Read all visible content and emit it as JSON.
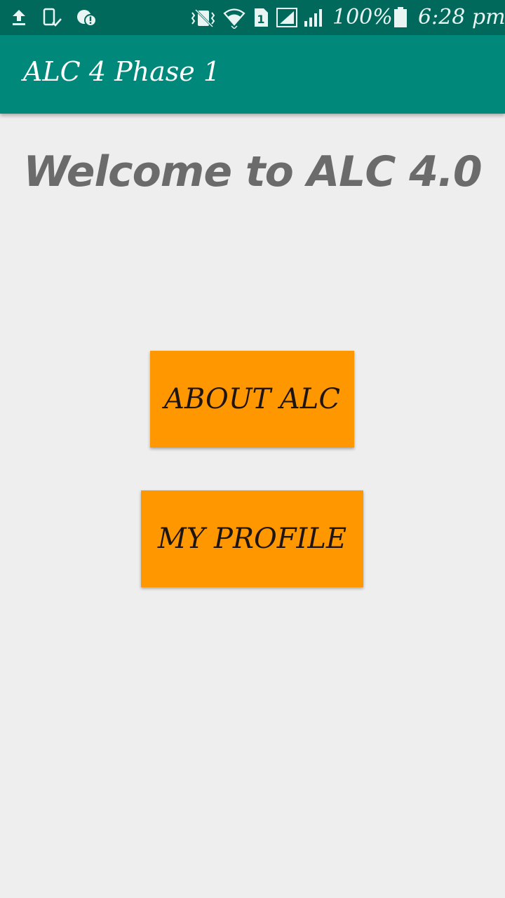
{
  "status_bar": {
    "icons": [
      "upload-icon",
      "phone-check-icon",
      "alert-badge-icon",
      "vibrate-icon",
      "wifi-icon",
      "sim1-icon",
      "signal-icon",
      "signal-icon-2",
      "battery-icon"
    ],
    "battery_percent": "100%",
    "time": "6:28 pm"
  },
  "app_bar": {
    "title": "ALC 4 Phase 1"
  },
  "main": {
    "welcome_text": "Welcome to ALC 4.0",
    "about_button_label": "ABOUT ALC",
    "profile_button_label": "MY PROFILE"
  },
  "colors": {
    "status_bar": "#00695c",
    "app_bar": "#00897b",
    "background": "#eeeeee",
    "button": "#ff9800",
    "welcome_text": "#6b6b6b"
  }
}
